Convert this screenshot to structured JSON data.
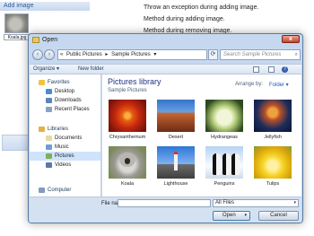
{
  "background": {
    "header_label": "Add image",
    "thumb_caption": "Koala.jpg",
    "status_lines": [
      "Throw an exception during adding image.",
      "Method during adding image.",
      "Method during removing image."
    ]
  },
  "dialog": {
    "title": "Open",
    "close_glyph": "x",
    "address": {
      "segments": [
        "«",
        "Public Pictures",
        "▸",
        "Sample Pictures",
        "▾"
      ]
    },
    "refresh_glyph": "⟳",
    "search_placeholder": "Search Sample Pictures",
    "search_glyph": "⌕",
    "back_glyph": "‹",
    "forward_glyph": "›",
    "toolbar": {
      "organize": "Organize ▾",
      "new_folder": "New folder",
      "help_glyph": "?"
    },
    "nav": {
      "favorites": "Favorites",
      "favorites_items": [
        "Desktop",
        "Downloads",
        "Recent Places"
      ],
      "libraries": "Libraries",
      "libraries_items": [
        "Documents",
        "Music",
        "Pictures",
        "Videos"
      ],
      "selected": "Pictures",
      "computer": "Computer"
    },
    "library": {
      "title": "Pictures library",
      "subtitle": "Sample Pictures",
      "arrange_label": "Arrange by:",
      "arrange_value": "Folder ▾"
    },
    "files": [
      "Chrysanthemum",
      "Desert",
      "Hydrangeas",
      "Jellyfish",
      "Koala",
      "Lighthouse",
      "Penguins",
      "Tulips"
    ],
    "filename_label": "File name:",
    "filename_value": "",
    "filetype_value": "All Files",
    "filetype_arrow": "▾",
    "open_label": "Open",
    "open_arrow": "▾",
    "cancel_label": "Cancel"
  }
}
